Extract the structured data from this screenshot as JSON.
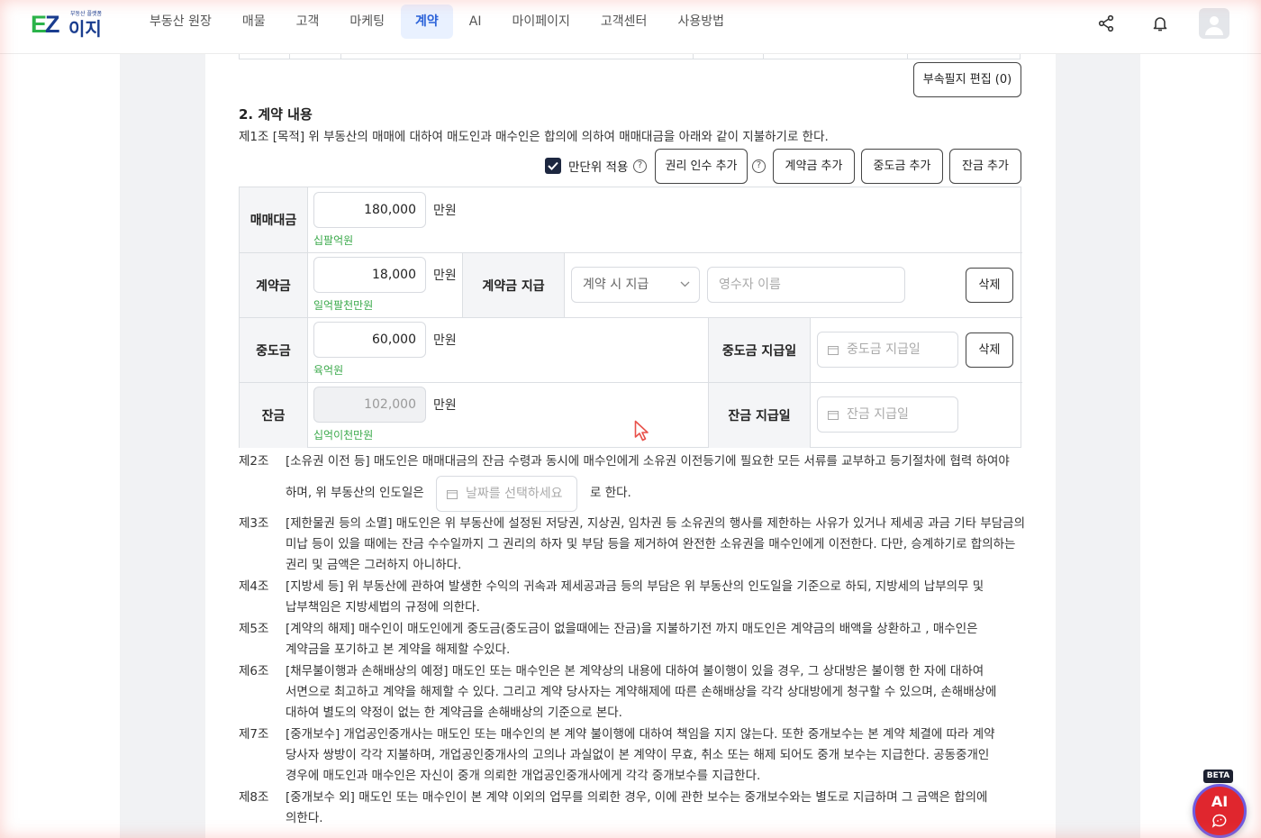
{
  "header": {
    "logo_text": "EZ이지",
    "logo_tagline": "부동산 플랫폼",
    "nav": [
      {
        "label": "부동산 원장"
      },
      {
        "label": "매물"
      },
      {
        "label": "고객"
      },
      {
        "label": "마케팅"
      },
      {
        "label": "계약",
        "active": true
      },
      {
        "label": "AI"
      },
      {
        "label": "마이페이지"
      },
      {
        "label": "고객센터"
      },
      {
        "label": "사용방법"
      }
    ]
  },
  "attachments_button": "부속필지 편집 (0)",
  "section": {
    "title": "2. 계약 내용",
    "article1": "제1조 [목적] 위 부동산의 매매에 대하여 매도인과 매수인은 합의에 의하여 매매대금을 아래와 같이 지불하기로 한다."
  },
  "options": {
    "unit_checkbox_label": "만단위 적용",
    "unit_checkbox_checked": true,
    "help_symbol": "?",
    "buttons": {
      "rights_transfer": "권리 인수 추가",
      "deposit": "계약금 추가",
      "interim": "중도금 추가",
      "balance": "잔금 추가"
    }
  },
  "payments": {
    "unit": "만원",
    "sale_price": {
      "label": "매매대금",
      "value": "180,000",
      "hangul": "십팔억원"
    },
    "deposit": {
      "label": "계약금",
      "value": "18,000",
      "hangul": "일억팔천만원",
      "pay_label": "계약금 지급",
      "pay_select": "계약 시 지급",
      "receiver_placeholder": "영수자 이름",
      "delete": "삭제"
    },
    "interim": {
      "label": "중도금",
      "value": "60,000",
      "hangul": "육억원",
      "date_label": "중도금 지급일",
      "date_placeholder": "중도금 지급일",
      "delete": "삭제"
    },
    "balance": {
      "label": "잔금",
      "value": "102,000",
      "hangul": "십억이천만원",
      "date_label": "잔금 지급일",
      "date_placeholder": "잔금 지급일"
    }
  },
  "articles": [
    {
      "num": "제2조",
      "lines": [
        "[소유권 이전 등] 매도인은 매매대금의 잔금 수령과 동시에 매수인에게 소유권 이전등기에 필요한 모든 서류를 교부하고 등기절차에 협력 하여야"
      ],
      "line2_prefix": "하며, 위 부동산의 인도일은",
      "line2_date_placeholder": "날짜를 선택하세요",
      "line2_suffix": "로 한다."
    },
    {
      "num": "제3조",
      "lines": [
        "[제한물권 등의 소멸] 매도인은 위 부동산에 설정된 저당권, 지상권, 임차권 등 소유권의 행사를 제한하는 사유가 있거나 제세공 과금 기타 부담금의",
        "미납 등이 있을 때에는 잔금 수수일까지 그 권리의 하자 및 부담 등을 제거하여 완전한 소유권을 매수인에게 이전한다. 다만, 승계하기로 합의하는",
        "권리 및 금액은 그러하지 아니하다."
      ]
    },
    {
      "num": "제4조",
      "lines": [
        "[지방세 등] 위 부동산에 관하여 발생한 수익의 귀속과 제세공과금 등의 부담은 위 부동산의 인도일을 기준으로 하되, 지방세의 납부의무 및",
        "납부책임은 지방세법의 규정에 의한다."
      ]
    },
    {
      "num": "제5조",
      "lines": [
        "[계약의 해제] 매수인이 매도인에게 중도금(중도금이 없을때에는 잔금)을 지불하기전 까지 매도인은 계약금의 배액을 상환하고 , 매수인은",
        "계약금을 포기하고 본 계약을 해제할 수있다."
      ]
    },
    {
      "num": "제6조",
      "lines": [
        "[채무불이행과 손해배상의 예정] 매도인 또는 매수인은 본 계약상의 내용에 대하여 불이행이 있을 경우, 그 상대방은 불이행 한 자에 대하여",
        "서면으로 최고하고 계약을 해제할 수 있다. 그리고 계약 당사자는 계약해제에 따른 손해배상을 각각 상대방에게 청구할 수 있으며, 손해배상에",
        "대하여 별도의 약정이 없는 한 계약금을 손해배상의 기준으로 본다."
      ]
    },
    {
      "num": "제7조",
      "lines": [
        "[중개보수] 개업공인중개사는 매도인 또는 매수인의 본 계약 불이행에 대하여 책임을 지지 않는다. 또한 중개보수는 본 계약 체결에 따라 계약",
        "당사자 쌍방이 각각 지불하며, 개업공인중개사의 고의나 과실없이 본 계약이 무효, 취소 또는 해제 되어도 중개 보수는 지급한다. 공동중개인",
        "경우에 매도인과 매수인은 자신이 중개 의뢰한 개업공인중개사에게 각각 중개보수를 지급한다."
      ]
    },
    {
      "num": "제8조",
      "lines": [
        "[중개보수 외] 매도인 또는 매수인이 본 계약 이외의 업무를 의뢰한 경우, 이에 관한 보수는 중개보수와는 별도로 지급하며 그 금액은 합의에",
        "의한다."
      ]
    }
  ],
  "ai_fab": {
    "label": "AI",
    "badge": "BETA"
  },
  "colors": {
    "accent": "#2a62d9",
    "hangul_green": "#3aa94a",
    "ai_red": "#e0262e"
  }
}
